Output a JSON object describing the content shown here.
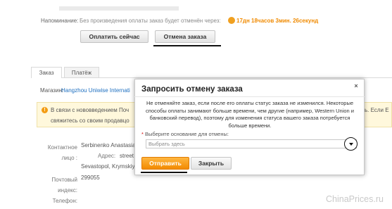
{
  "page": {
    "reminder_label": "Напоминание:",
    "reminder_text": "Без произведения оплаты заказ будет отменён через:",
    "timer": "17дн 18часов 3мин. 26секунд",
    "pay_button": "Оплатить сейчас",
    "cancel_order_button": "Отмена заказа",
    "tabs": [
      {
        "label": "Заказ"
      },
      {
        "label": "Платёж"
      }
    ],
    "shop_label": "Магазин:",
    "shop_name": "Hangzhou Uniwise Internati",
    "notice_line1": "В связи с нововведением Поч",
    "notice_line2": "свяжитесь со своим продавцо",
    "notice_right": "ь. Если Е",
    "contact_label": "Контактное лицо :",
    "contact_name": "Serbinenko Anastasia",
    "address_label": "Адрес:",
    "address_line1": "street",
    "address_line2": "Sevastopol, Krymskiy",
    "postal_label": "Почтовый индекс:",
    "postal_code": "299055",
    "phone_label": "Телефон:",
    "watermark": "ChinaPrices.ru"
  },
  "modal": {
    "title": "Запросить отмену заказа",
    "close_glyph": "×",
    "info": "Не отменяйте заказ, если после его оплаты статус заказа не изменился. Некоторые способы оплаты занимают больше времени, чем другие (например, Western Union и банковский перевод), поэтому для изменения статуса вашего заказа потребуется больше времени.",
    "reason_star": "*",
    "reason_label": "Выберите основание для отмены:",
    "reason_placeholder": "Выбрать здесь",
    "send_button": "Отправить",
    "close_button": "Закрыть"
  },
  "colors": {
    "accent_orange": "#f28a00",
    "timer_orange": "#f08a00",
    "link_blue": "#1d6fc0",
    "notice_bg": "#fff8dc"
  },
  "icons": [
    "clock-icon",
    "warning-icon",
    "close-icon",
    "chevron-down-icon"
  ]
}
